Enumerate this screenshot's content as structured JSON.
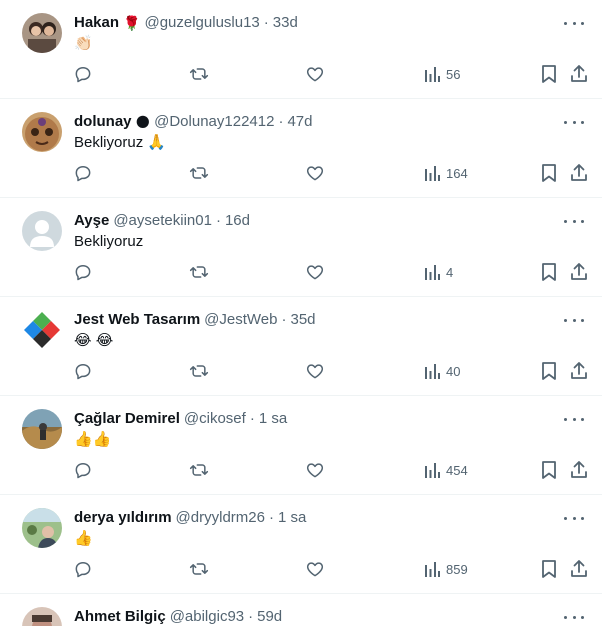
{
  "tweets": [
    {
      "name": "Hakan",
      "badge": "🌹",
      "handle": "@guzelguluslu13",
      "time": "33d",
      "text": "👏🏻",
      "views": "56",
      "avatar_colors": [
        "#7a6a5d",
        "#c9a78d"
      ]
    },
    {
      "name": "dolunay",
      "badge": "🌑",
      "handle": "@Dolunay122412",
      "time": "47d",
      "text": "Bekliyoruz 🙏",
      "views": "164",
      "avatar_colors": [
        "#b7895a",
        "#5d3a22"
      ]
    },
    {
      "name": "Ayşe",
      "badge": "",
      "handle": "@aysetekiin01",
      "time": "16d",
      "text": "Bekliyoruz",
      "views": "4",
      "avatar_colors": [
        "#cfd9de",
        "#ffffff"
      ]
    },
    {
      "name": "Jest Web Tasarım",
      "badge": "",
      "handle": "@JestWeb",
      "time": "35d",
      "text": "😂 😂",
      "views": "40",
      "avatar_colors": [
        "#ffffff",
        "#2b2b2b"
      ]
    },
    {
      "name": "Çağlar Demirel",
      "badge": "",
      "handle": "@cikosef",
      "time": "1 sa",
      "text": "👍👍",
      "views": "454",
      "avatar_colors": [
        "#5a7a8c",
        "#b58b4c"
      ]
    },
    {
      "name": "derya yıldırım",
      "badge": "",
      "handle": "@dryyldrm26",
      "time": "1 sa",
      "text": "👍",
      "views": "859",
      "avatar_colors": [
        "#7da36a",
        "#3d5a35"
      ]
    },
    {
      "name": "Ahmet Bilgiç",
      "badge": "",
      "handle": "@abilgic93",
      "time": "59d",
      "text": "",
      "views": "",
      "avatar_colors": [
        "#c7a89a",
        "#6d5144"
      ]
    }
  ],
  "separator": "·",
  "colors": {
    "text": "#0f1419",
    "muted": "#536471",
    "border": "#eff3f4"
  }
}
